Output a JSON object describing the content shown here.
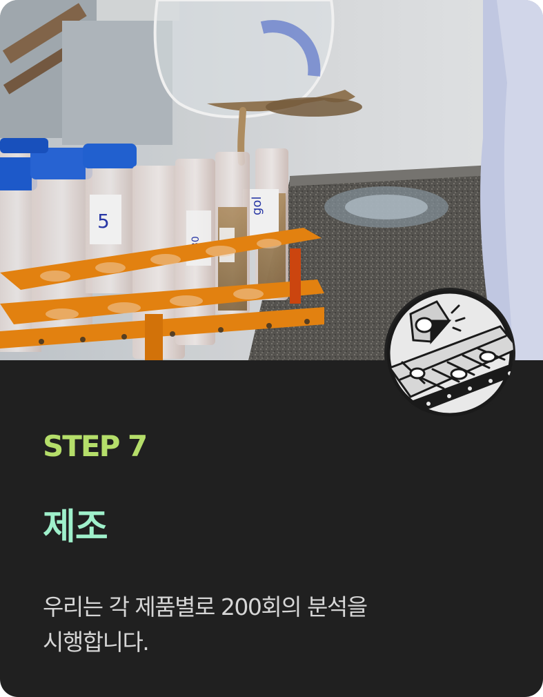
{
  "hero": {
    "image_name": "lab-test-tubes-photo",
    "tube_labels": [
      "5",
      "30"
    ]
  },
  "badge": {
    "icon_name": "conveyor-inspection-icon"
  },
  "content": {
    "step_label": "STEP 7",
    "title": "제조",
    "description_lines": [
      "우리는 각 제품별로 200회의 분석을",
      "시행합니다."
    ]
  },
  "colors": {
    "background": "#202020",
    "step_accent": "#b5de6a",
    "title_accent": "#9ff0cb",
    "body_text": "#d6d6d6",
    "rack_orange": "#f18a12",
    "cap_blue": "#1f5fd6"
  }
}
